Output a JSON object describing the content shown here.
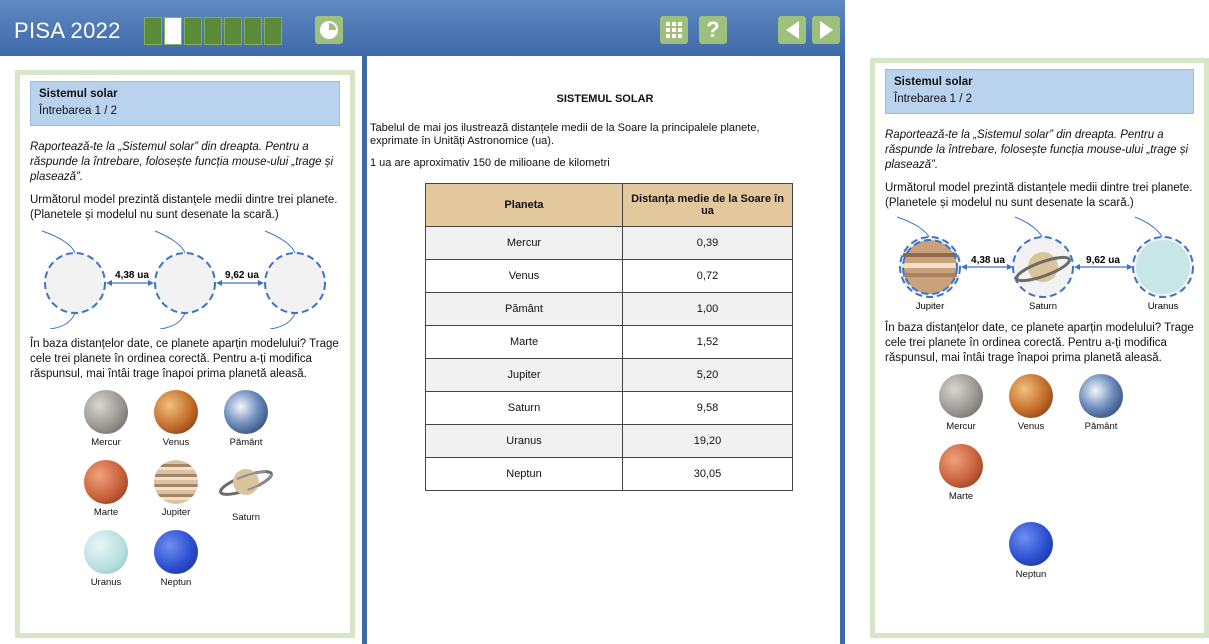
{
  "app": {
    "title": "PISA 2022"
  },
  "question": {
    "title": "Sistemul solar",
    "number": "Întrebarea 1 / 2",
    "intro": "Raportează-te la „Sistemul solar” din dreapta. Pentru a răspunde la întrebare, folosește funcția mouse-ului „trage și plasează”.",
    "model_text": "Următorul model prezintă distanțele medii dintre trei planete. (Planetele și modelul nu sunt desenate la scară.)",
    "distance_1": "4,38 ua",
    "distance_2": "9,62 ua",
    "prompt": "În baza distanțelor date, ce planete aparțin modelului? Trage cele trei planete în ordinea corectă. Pentru a-ți modifica răspunsul, mai întâi trage înapoi prima planetă aleasă.",
    "planets_left": [
      "Mercur",
      "Venus",
      "Pământ",
      "Marte",
      "Jupiter",
      "Saturn",
      "Uranus",
      "Neptun"
    ],
    "placed": [
      "Jupiter",
      "Saturn",
      "Uranus"
    ],
    "planets_right": [
      "Mercur",
      "Venus",
      "Pământ",
      "Marte",
      "Neptun"
    ]
  },
  "stimulus": {
    "title": "SISTEMUL SOLAR",
    "intro": "Tabelul de mai jos ilustrează distanțele medii de la Soare la principalele planete, exprimate în Unități Astronomice (ua).",
    "ua_note": "1 ua are aproximativ 150 de milioane de kilometri",
    "col_planet": "Planeta",
    "col_distance": "Distanța medie de la Soare în ua",
    "rows": [
      {
        "planet": "Mercur",
        "distance": "0,39"
      },
      {
        "planet": "Venus",
        "distance": "0,72"
      },
      {
        "planet": "Pământ",
        "distance": "1,00"
      },
      {
        "planet": "Marte",
        "distance": "1,52"
      },
      {
        "planet": "Jupiter",
        "distance": "5,20"
      },
      {
        "planet": "Saturn",
        "distance": "9,58"
      },
      {
        "planet": "Uranus",
        "distance": "19,20"
      },
      {
        "planet": "Neptun",
        "distance": "30,05"
      }
    ]
  },
  "colors": {
    "header": "#4a75b2",
    "panel_border": "#d7e6c7",
    "question_header": "#b9d3ef",
    "table_header": "#e2c89c",
    "progress": "#5b8a3a"
  },
  "icons": {
    "timer": "timer-icon",
    "calculator": "calculator-icon",
    "help": "help-icon",
    "back": "previous-arrow-icon",
    "next": "next-arrow-icon"
  }
}
